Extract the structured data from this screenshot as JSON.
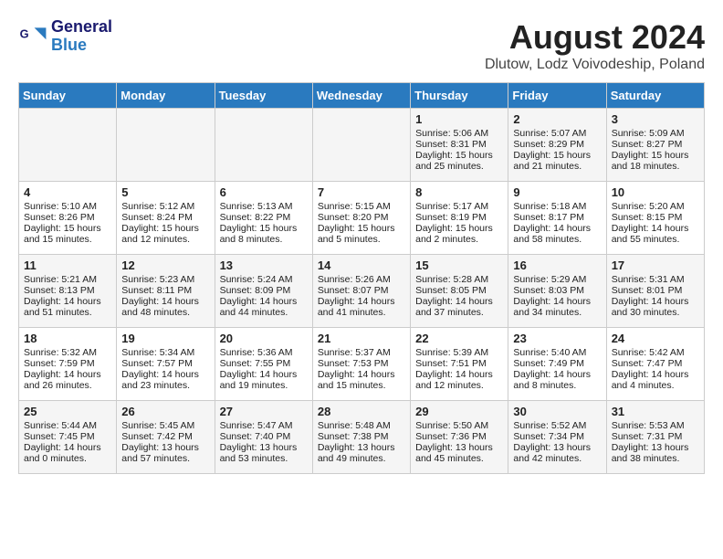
{
  "header": {
    "logo_line1": "General",
    "logo_line2": "Blue",
    "month_year": "August 2024",
    "location": "Dlutow, Lodz Voivodeship, Poland"
  },
  "weekdays": [
    "Sunday",
    "Monday",
    "Tuesday",
    "Wednesday",
    "Thursday",
    "Friday",
    "Saturday"
  ],
  "weeks": [
    [
      {
        "day": "",
        "info": ""
      },
      {
        "day": "",
        "info": ""
      },
      {
        "day": "",
        "info": ""
      },
      {
        "day": "",
        "info": ""
      },
      {
        "day": "1",
        "info": "Sunrise: 5:06 AM\nSunset: 8:31 PM\nDaylight: 15 hours\nand 25 minutes."
      },
      {
        "day": "2",
        "info": "Sunrise: 5:07 AM\nSunset: 8:29 PM\nDaylight: 15 hours\nand 21 minutes."
      },
      {
        "day": "3",
        "info": "Sunrise: 5:09 AM\nSunset: 8:27 PM\nDaylight: 15 hours\nand 18 minutes."
      }
    ],
    [
      {
        "day": "4",
        "info": "Sunrise: 5:10 AM\nSunset: 8:26 PM\nDaylight: 15 hours\nand 15 minutes."
      },
      {
        "day": "5",
        "info": "Sunrise: 5:12 AM\nSunset: 8:24 PM\nDaylight: 15 hours\nand 12 minutes."
      },
      {
        "day": "6",
        "info": "Sunrise: 5:13 AM\nSunset: 8:22 PM\nDaylight: 15 hours\nand 8 minutes."
      },
      {
        "day": "7",
        "info": "Sunrise: 5:15 AM\nSunset: 8:20 PM\nDaylight: 15 hours\nand 5 minutes."
      },
      {
        "day": "8",
        "info": "Sunrise: 5:17 AM\nSunset: 8:19 PM\nDaylight: 15 hours\nand 2 minutes."
      },
      {
        "day": "9",
        "info": "Sunrise: 5:18 AM\nSunset: 8:17 PM\nDaylight: 14 hours\nand 58 minutes."
      },
      {
        "day": "10",
        "info": "Sunrise: 5:20 AM\nSunset: 8:15 PM\nDaylight: 14 hours\nand 55 minutes."
      }
    ],
    [
      {
        "day": "11",
        "info": "Sunrise: 5:21 AM\nSunset: 8:13 PM\nDaylight: 14 hours\nand 51 minutes."
      },
      {
        "day": "12",
        "info": "Sunrise: 5:23 AM\nSunset: 8:11 PM\nDaylight: 14 hours\nand 48 minutes."
      },
      {
        "day": "13",
        "info": "Sunrise: 5:24 AM\nSunset: 8:09 PM\nDaylight: 14 hours\nand 44 minutes."
      },
      {
        "day": "14",
        "info": "Sunrise: 5:26 AM\nSunset: 8:07 PM\nDaylight: 14 hours\nand 41 minutes."
      },
      {
        "day": "15",
        "info": "Sunrise: 5:28 AM\nSunset: 8:05 PM\nDaylight: 14 hours\nand 37 minutes."
      },
      {
        "day": "16",
        "info": "Sunrise: 5:29 AM\nSunset: 8:03 PM\nDaylight: 14 hours\nand 34 minutes."
      },
      {
        "day": "17",
        "info": "Sunrise: 5:31 AM\nSunset: 8:01 PM\nDaylight: 14 hours\nand 30 minutes."
      }
    ],
    [
      {
        "day": "18",
        "info": "Sunrise: 5:32 AM\nSunset: 7:59 PM\nDaylight: 14 hours\nand 26 minutes."
      },
      {
        "day": "19",
        "info": "Sunrise: 5:34 AM\nSunset: 7:57 PM\nDaylight: 14 hours\nand 23 minutes."
      },
      {
        "day": "20",
        "info": "Sunrise: 5:36 AM\nSunset: 7:55 PM\nDaylight: 14 hours\nand 19 minutes."
      },
      {
        "day": "21",
        "info": "Sunrise: 5:37 AM\nSunset: 7:53 PM\nDaylight: 14 hours\nand 15 minutes."
      },
      {
        "day": "22",
        "info": "Sunrise: 5:39 AM\nSunset: 7:51 PM\nDaylight: 14 hours\nand 12 minutes."
      },
      {
        "day": "23",
        "info": "Sunrise: 5:40 AM\nSunset: 7:49 PM\nDaylight: 14 hours\nand 8 minutes."
      },
      {
        "day": "24",
        "info": "Sunrise: 5:42 AM\nSunset: 7:47 PM\nDaylight: 14 hours\nand 4 minutes."
      }
    ],
    [
      {
        "day": "25",
        "info": "Sunrise: 5:44 AM\nSunset: 7:45 PM\nDaylight: 14 hours\nand 0 minutes."
      },
      {
        "day": "26",
        "info": "Sunrise: 5:45 AM\nSunset: 7:42 PM\nDaylight: 13 hours\nand 57 minutes."
      },
      {
        "day": "27",
        "info": "Sunrise: 5:47 AM\nSunset: 7:40 PM\nDaylight: 13 hours\nand 53 minutes."
      },
      {
        "day": "28",
        "info": "Sunrise: 5:48 AM\nSunset: 7:38 PM\nDaylight: 13 hours\nand 49 minutes."
      },
      {
        "day": "29",
        "info": "Sunrise: 5:50 AM\nSunset: 7:36 PM\nDaylight: 13 hours\nand 45 minutes."
      },
      {
        "day": "30",
        "info": "Sunrise: 5:52 AM\nSunset: 7:34 PM\nDaylight: 13 hours\nand 42 minutes."
      },
      {
        "day": "31",
        "info": "Sunrise: 5:53 AM\nSunset: 7:31 PM\nDaylight: 13 hours\nand 38 minutes."
      }
    ]
  ]
}
